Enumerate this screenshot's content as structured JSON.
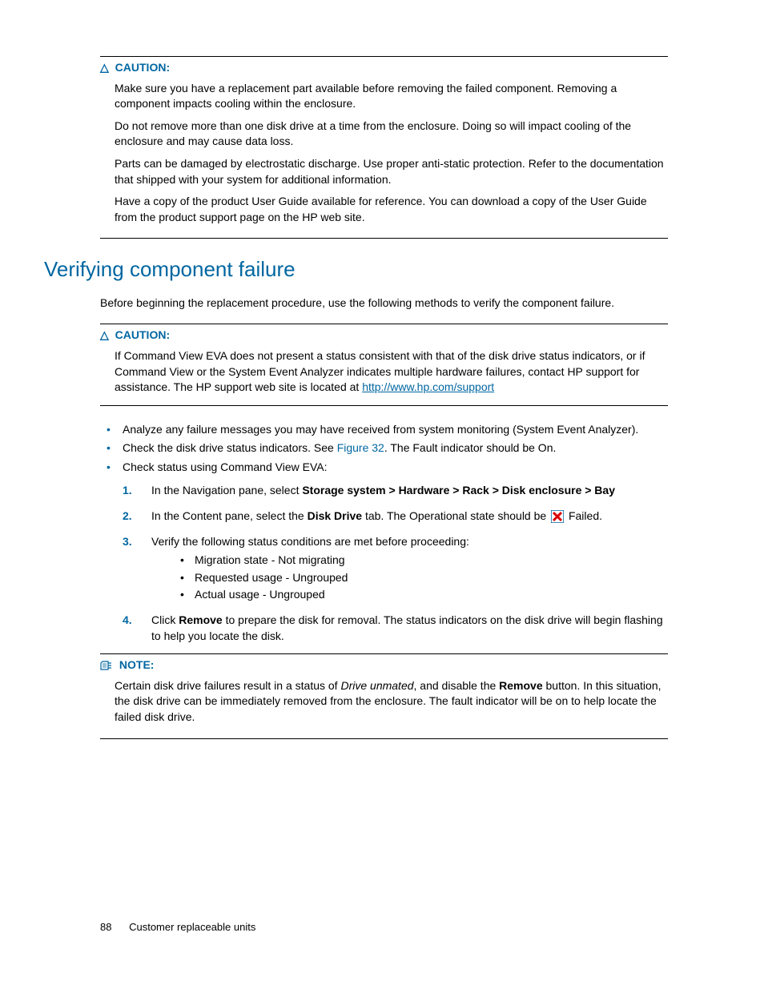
{
  "caution1": {
    "label": "CAUTION:",
    "p1": "Make sure you have a replacement part available before removing the failed component. Removing a component impacts cooling within the enclosure.",
    "p2": "Do not remove more than one disk drive at a time from the enclosure. Doing so will impact cooling of the enclosure and may cause data loss.",
    "p3": "Parts can be damaged by electrostatic discharge. Use proper anti-static protection. Refer to the documentation that shipped with your system for additional information.",
    "p4": "Have a copy of the product User Guide available for reference. You can download a copy of the User Guide from the product support page on the HP web site."
  },
  "section": {
    "title": "Verifying component failure",
    "intro": "Before beginning the replacement procedure, use the following methods to verify the component failure."
  },
  "caution2": {
    "label": "CAUTION:",
    "text_before_link": "If Command View EVA does not present a status consistent with that of the disk drive status indicators, or if Command View or the System Event Analyzer indicates multiple hardware failures, contact HP support for assistance. The HP support web site is located at ",
    "link_text": "http://www.hp.com/support"
  },
  "bullets": {
    "b1": "Analyze any failure messages you may have received from system monitoring (System Event Analyzer).",
    "b2_before": "Check the disk drive status indicators. See ",
    "b2_fig": "Figure 32",
    "b2_after": ". The Fault indicator should be On.",
    "b3": "Check status using Command View EVA:"
  },
  "steps": {
    "s1_before": "In the Navigation pane, select ",
    "s1_bold": "Storage system > Hardware > Rack > Disk enclosure > Bay",
    "s2_before": "In the Content pane, select the ",
    "s2_bold": "Disk Drive",
    "s2_mid": " tab. The Operational state should be ",
    "s2_after": " Failed.",
    "s3": "Verify the following status conditions are met before proceeding:",
    "s3_sub1": "Migration state - Not migrating",
    "s3_sub2": "Requested usage - Ungrouped",
    "s3_sub3": "Actual usage - Ungrouped",
    "s4_before": "Click ",
    "s4_bold": "Remove",
    "s4_after": " to prepare the disk for removal. The status indicators on the disk drive will begin flashing to help you locate the disk."
  },
  "note": {
    "label": "NOTE:",
    "text_before_italic": "Certain disk drive failures result in a status of ",
    "italic": "Drive unmated",
    "text_mid": ", and disable the ",
    "bold": "Remove",
    "text_after": " button. In this situation, the disk drive can be immediately removed from the enclosure. The fault indicator will be on to help locate the failed disk drive."
  },
  "footer": {
    "page": "88",
    "section": "Customer replaceable units"
  }
}
